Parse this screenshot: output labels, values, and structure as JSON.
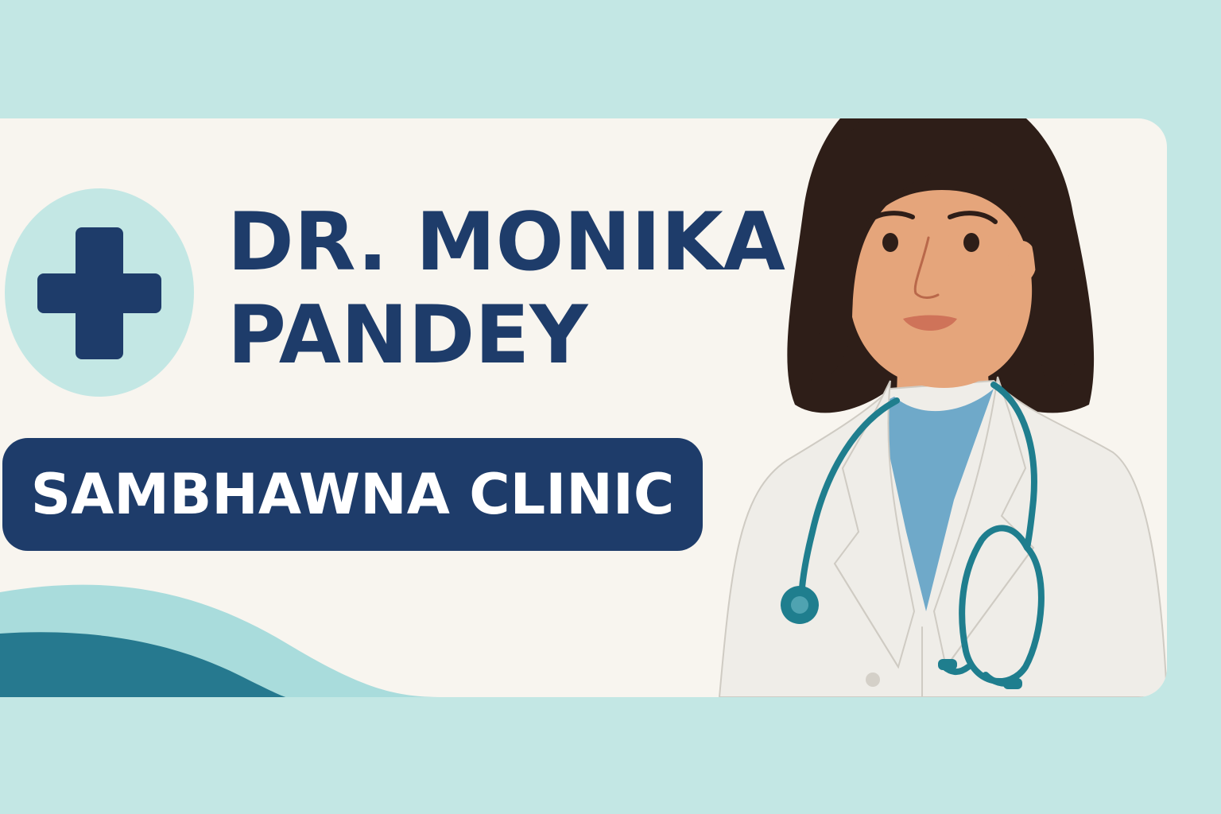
{
  "doctor": {
    "name_line1": "DR. MONIKA",
    "name_line2": "PANDEY"
  },
  "clinic": {
    "name": "SAMBHAWNA CLINIC"
  },
  "icons": {
    "badge": "medical-cross-icon",
    "illustration": "doctor-with-stethoscope"
  },
  "colors": {
    "page_background": "#c3e7e4",
    "card_background": "#f8f5ef",
    "navy": "#1e3c6a",
    "badge_fill": "#c3e7e4",
    "clinic_text": "#ffffff",
    "wave_light": "#a9dcdc",
    "wave_dark": "#26798f",
    "teal": "#1f7e8e",
    "hair": "#2e1e18",
    "skin": "#e5a57b",
    "coat": "#efede8",
    "scrubs": "#6fa9c9"
  }
}
